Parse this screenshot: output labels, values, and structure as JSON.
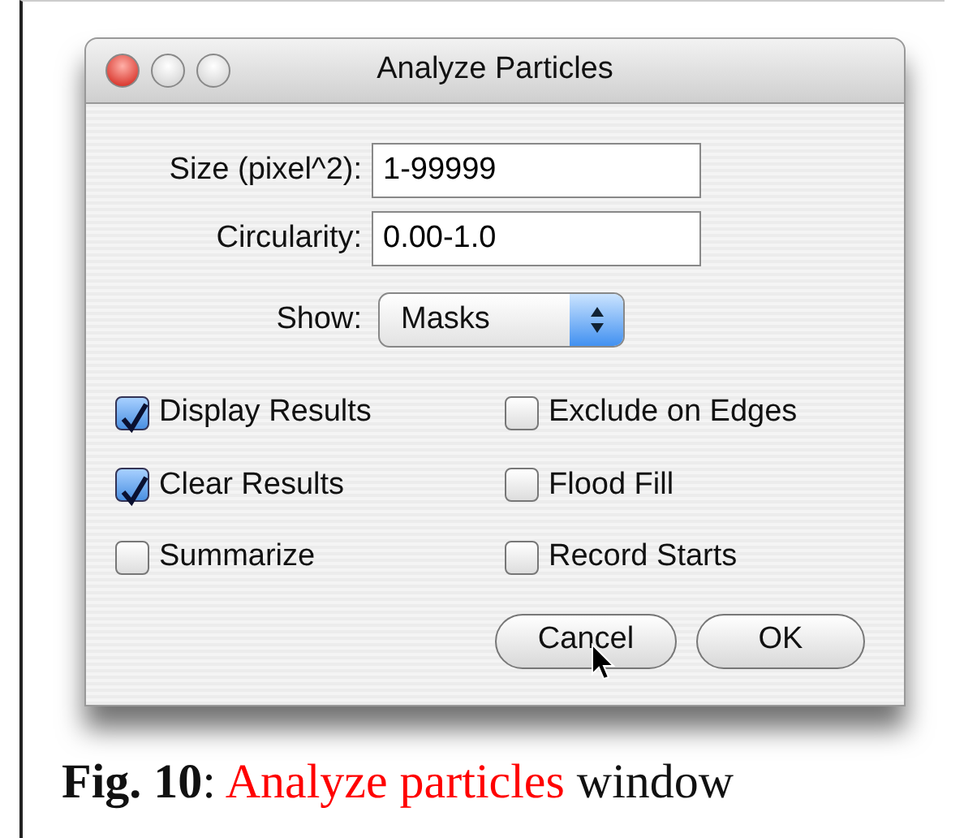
{
  "window": {
    "title": "Analyze Particles"
  },
  "fields": [
    {
      "label": "Size (pixel^2):",
      "value": "1-99999"
    },
    {
      "label": "Circularity:",
      "value": "0.00-1.0"
    }
  ],
  "show": {
    "label": "Show:",
    "value": "Masks"
  },
  "checkboxes": [
    {
      "label": "Display Results",
      "checked": true
    },
    {
      "label": "Exclude on Edges",
      "checked": false
    },
    {
      "label": "Clear Results",
      "checked": true
    },
    {
      "label": "Flood Fill",
      "checked": false
    },
    {
      "label": "Summarize",
      "checked": false
    },
    {
      "label": "Record Starts",
      "checked": false
    }
  ],
  "buttons": [
    "Cancel",
    "OK"
  ],
  "caption": [
    {
      "text": "Fig. 10",
      "kind": "bold"
    },
    {
      "text": ": ",
      "kind": "plain"
    },
    {
      "text": "Analyze particles",
      "kind": "highlight"
    },
    {
      "text": " window",
      "kind": "plain"
    }
  ]
}
